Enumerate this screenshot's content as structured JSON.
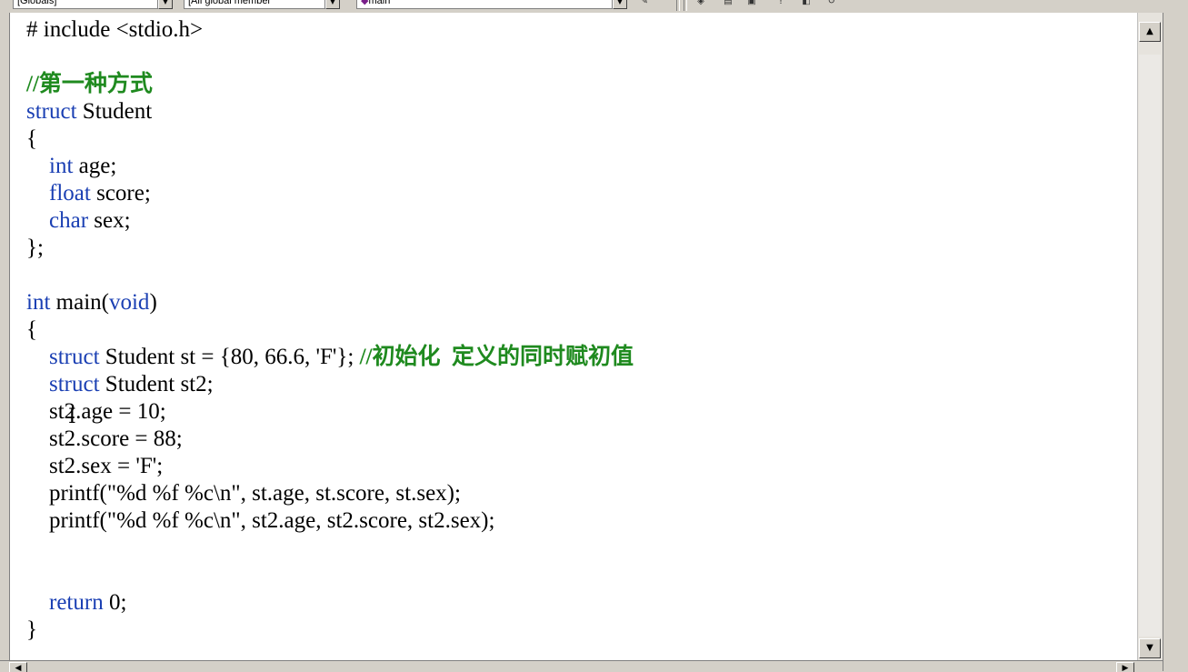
{
  "toolbar": {
    "scope_combo": "[Globals]",
    "members_combo": "[All global member",
    "function_combo": "main",
    "drop_glyph": "▼",
    "icons": [
      "wizard-icon",
      "build-icon",
      "compile-icon",
      "stop-icon",
      "go-icon",
      "insert-breakpoint-icon",
      "undo-icon"
    ]
  },
  "editor": {
    "lines": [
      [
        {
          "t": "# include <stdio.h>",
          "c": "plain"
        }
      ],
      [],
      [
        {
          "t": "//第一种方式",
          "c": "comment"
        }
      ],
      [
        {
          "t": "struct",
          "c": "keyword"
        },
        {
          "t": " Student",
          "c": "plain"
        }
      ],
      [
        {
          "t": "{",
          "c": "plain"
        }
      ],
      [
        {
          "t": "    ",
          "c": "plain"
        },
        {
          "t": "int",
          "c": "keyword"
        },
        {
          "t": " age;",
          "c": "plain"
        }
      ],
      [
        {
          "t": "    ",
          "c": "plain"
        },
        {
          "t": "float",
          "c": "keyword"
        },
        {
          "t": " score;",
          "c": "plain"
        }
      ],
      [
        {
          "t": "    ",
          "c": "plain"
        },
        {
          "t": "char",
          "c": "keyword"
        },
        {
          "t": " sex;",
          "c": "plain"
        }
      ],
      [
        {
          "t": "};",
          "c": "plain"
        }
      ],
      [],
      [
        {
          "t": "int",
          "c": "keyword"
        },
        {
          "t": " main(",
          "c": "plain"
        },
        {
          "t": "void",
          "c": "keyword"
        },
        {
          "t": ")",
          "c": "plain"
        }
      ],
      [
        {
          "t": "{",
          "c": "plain"
        }
      ],
      [
        {
          "t": "    ",
          "c": "plain"
        },
        {
          "t": "struct",
          "c": "keyword"
        },
        {
          "t": " Student st = {80, 66.6, 'F'}; ",
          "c": "plain"
        },
        {
          "t": "//初始化  定义的同时赋初值",
          "c": "comment"
        }
      ],
      [
        {
          "t": "    ",
          "c": "plain"
        },
        {
          "t": "struct",
          "c": "keyword"
        },
        {
          "t": " Student st2;",
          "c": "plain"
        }
      ],
      [
        {
          "t": "    st2.age = 10;",
          "c": "plain"
        }
      ],
      [
        {
          "t": "    st2.score = 88;",
          "c": "plain"
        }
      ],
      [
        {
          "t": "    st2.sex = 'F';",
          "c": "plain"
        }
      ],
      [
        {
          "t": "    printf(\"%d %f %c\\n\", st.age, st.score, st.sex);",
          "c": "plain"
        }
      ],
      [
        {
          "t": "    printf(\"%d %f %c\\n\", st2.age, st2.score, st2.sex);",
          "c": "plain"
        }
      ],
      [],
      [],
      [
        {
          "t": "    ",
          "c": "plain"
        },
        {
          "t": "return",
          "c": "keyword"
        },
        {
          "t": " 0;",
          "c": "plain"
        }
      ],
      [
        {
          "t": "}",
          "c": "plain"
        }
      ]
    ],
    "cursor_glyph": "I"
  },
  "scrollbar": {
    "up_glyph": "▲",
    "down_glyph": "▼",
    "left_glyph": "◀",
    "right_glyph": "▶"
  },
  "colors": {
    "keyword": "#1a3fb3",
    "comment": "#1f8a1f",
    "text": "#000000",
    "background": "#ffffff"
  }
}
